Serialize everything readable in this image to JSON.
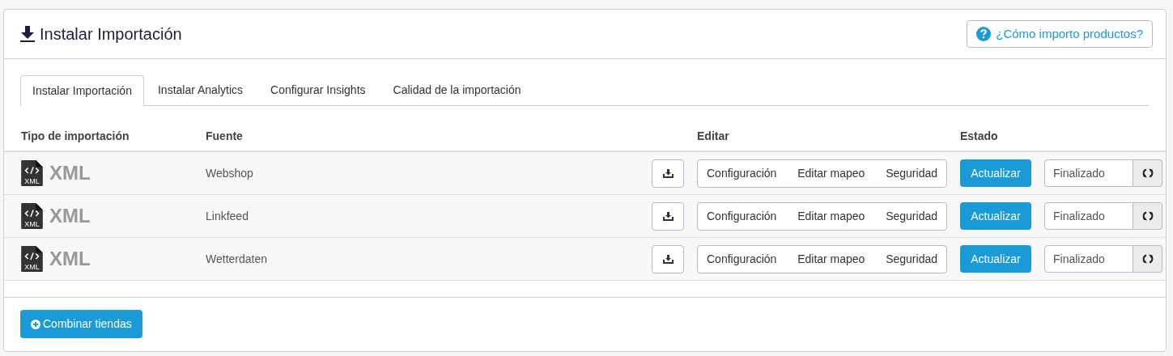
{
  "header": {
    "title": "Instalar Importación",
    "help_button": "¿Cómo importo productos?"
  },
  "tabs": [
    {
      "label": "Instalar Importación",
      "selected": true
    },
    {
      "label": "Instalar Analytics",
      "selected": false
    },
    {
      "label": "Configurar Insights",
      "selected": false
    },
    {
      "label": "Calidad de la importación",
      "selected": false
    }
  ],
  "table": {
    "columns": [
      "Tipo de importación",
      "Fuente",
      "Editar",
      "Estado"
    ],
    "rows": [
      {
        "icon_label": "XML",
        "type": "XML",
        "source": "Webshop",
        "edit_actions": [
          "Configuración",
          "Editar mapeo",
          "Seguridad"
        ],
        "update_button": "Actualizar",
        "status": "Finalizado"
      },
      {
        "icon_label": "XML",
        "type": "XML",
        "source": "Linkfeed",
        "edit_actions": [
          "Configuración",
          "Editar mapeo",
          "Seguridad"
        ],
        "update_button": "Actualizar",
        "status": "Finalizado"
      },
      {
        "icon_label": "XML",
        "type": "XML",
        "source": "Wetterdaten",
        "edit_actions": [
          "Configuración",
          "Editar mapeo",
          "Seguridad"
        ],
        "update_button": "Actualizar",
        "status": "Finalizado"
      }
    ]
  },
  "footer": {
    "button": "Combinar tiendas"
  }
}
